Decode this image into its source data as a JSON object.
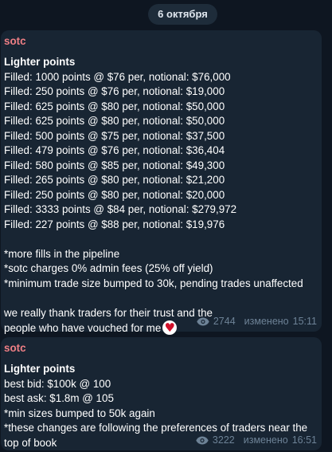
{
  "date_label": "6 октября",
  "messages": [
    {
      "sender": "sotc",
      "title": "Lighter points",
      "lines": [
        "Filled: 1000 points @ $76 per, notional: $76,000",
        "Filled: 250 points @ $76 per, notional: $19,000",
        "Filled: 625 points @ $80 per, notional: $50,000",
        "Filled: 625 points @ $80 per, notional: $50,000",
        "Filled: 500 points @ $75 per, notional: $37,500",
        "Filled: 479 points @ $76 per, notional: $36,404",
        "Filled: 580 points @ $85 per, notional: $49,300",
        "Filled: 265 points @ $80 per, notional: $21,200",
        "Filled: 250 points @ $80 per, notional: $20,000",
        "Filled: 3333 points @ $84 per, notional: $279,972",
        "Filled: 227 points @ $88 per, notional: $19,976"
      ],
      "notes": [
        "*more fills in the pipeline",
        "*sotc charges 0% admin fees (25% off yield)",
        "*minimum trade size bumped to 30k, pending trades unaffected"
      ],
      "closing": "we really thank traders for their trust and the people who have vouched for me",
      "views": "2744",
      "edited_label": "изменено",
      "time": "15:11"
    },
    {
      "sender": "sotc",
      "title": "Lighter points",
      "lines": [
        "best bid: $100k @ 100",
        "best ask: $1.8m @ 105",
        "*min sizes bumped to 50k again",
        "*these changes are following the preferences of traders near the top of book"
      ],
      "views": "3222",
      "edited_label": "изменено",
      "time": "16:51"
    }
  ],
  "colors": {
    "background": "#0e1621",
    "bubble": "#182533",
    "sender": "#ef7f85",
    "meta": "#6d8296"
  },
  "icons": {
    "views": "eye-icon",
    "emoji": "heart-emoji-icon"
  }
}
